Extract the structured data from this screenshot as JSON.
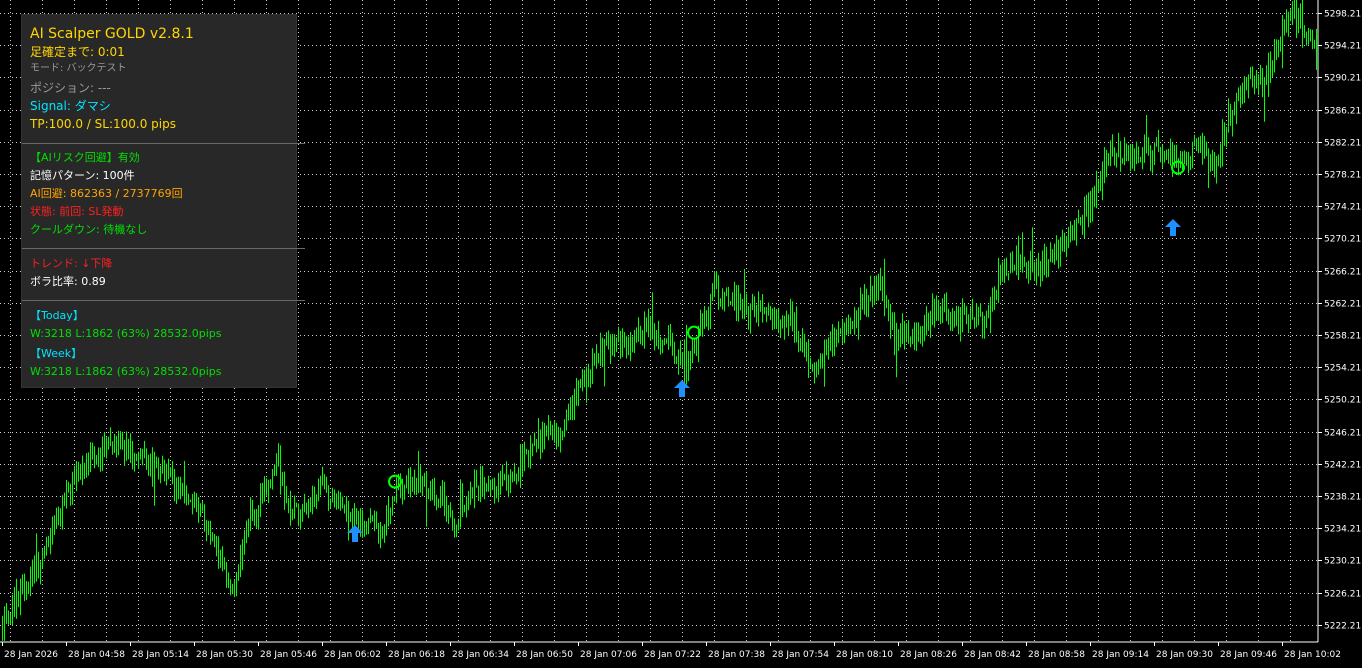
{
  "panel": {
    "title": "AI Scalper GOLD v2.8.1",
    "countdown": "足確定まで: 0:01",
    "mode": "モード: バックテスト",
    "position": "ポジション: ---",
    "signal_label": "Signal:",
    "signal_value": "ダマシ",
    "tp_sl": "TP:100.0 / SL:100.0 pips",
    "risk": "【AIリスク回避】有効",
    "memory": "記憶パターン: 100件",
    "avoid": "AI回避: 862363 / 2737769回",
    "state": "状態: 前回: SL発動",
    "cooldown": "クールダウン: 待機なし",
    "trend": "トレンド: ↓下降",
    "vol": "ボラ比率: 0.89",
    "today_h": "【Today】",
    "today": "W:3218 L:1862 (63%) 28532.0pips",
    "week_h": "【Week】",
    "week": "W:3218 L:1862 (63%) 28532.0pips",
    "colors": {
      "title": "#ffd700",
      "cyan": "#00e5ff",
      "green": "#00e000",
      "orange": "#ffa500",
      "red": "#ff2020",
      "white": "#ffffff",
      "gray": "#9a9a9a"
    }
  },
  "chart_data": {
    "type": "candlestick",
    "symbol": "GOLD",
    "y_ticks": [
      "5298.21",
      "5294.21",
      "5290.21",
      "5286.21",
      "5282.21",
      "5278.21",
      "5274.21",
      "5270.21",
      "5266.21",
      "5262.21",
      "5258.21",
      "5254.21",
      "5250.21",
      "5246.21",
      "5242.21",
      "5238.21",
      "5234.21",
      "5230.21",
      "5226.21",
      "5222.21"
    ],
    "x_ticks": [
      "28 Jan 2026",
      "28 Jan 04:58",
      "28 Jan 05:14",
      "28 Jan 05:30",
      "28 Jan 05:46",
      "28 Jan 06:02",
      "28 Jan 06:18",
      "28 Jan 06:34",
      "28 Jan 06:50",
      "28 Jan 07:06",
      "28 Jan 07:22",
      "28 Jan 07:38",
      "28 Jan 07:54",
      "28 Jan 08:10",
      "28 Jan 08:26",
      "28 Jan 08:42",
      "28 Jan 08:58",
      "28 Jan 09:14",
      "28 Jan 09:30",
      "28 Jan 09:46",
      "28 Jan 10:02"
    ],
    "ylim": [
      5220.21,
      5299.81
    ],
    "candle_color": "#00ff00",
    "grid_color": "#ffffff",
    "grid": true,
    "price_path": [
      [
        0,
        5221.5
      ],
      [
        20,
        5226
      ],
      [
        50,
        5233
      ],
      [
        75,
        5241
      ],
      [
        100,
        5244
      ],
      [
        115,
        5245
      ],
      [
        150,
        5242
      ],
      [
        190,
        5238
      ],
      [
        215,
        5233
      ],
      [
        232,
        5226
      ],
      [
        245,
        5234
      ],
      [
        262,
        5238
      ],
      [
        275,
        5243
      ],
      [
        290,
        5236
      ],
      [
        302,
        5236
      ],
      [
        322,
        5240
      ],
      [
        338,
        5237
      ],
      [
        360,
        5235
      ],
      [
        382,
        5234
      ],
      [
        395,
        5239
      ],
      [
        420,
        5240
      ],
      [
        440,
        5238
      ],
      [
        455,
        5235
      ],
      [
        475,
        5240
      ],
      [
        500,
        5239
      ],
      [
        520,
        5242
      ],
      [
        545,
        5247
      ],
      [
        560,
        5245
      ],
      [
        575,
        5251
      ],
      [
        600,
        5256
      ],
      [
        625,
        5257
      ],
      [
        650,
        5259
      ],
      [
        670,
        5257
      ],
      [
        685,
        5254
      ],
      [
        700,
        5259
      ],
      [
        715,
        5264
      ],
      [
        740,
        5262
      ],
      [
        765,
        5261
      ],
      [
        790,
        5260
      ],
      [
        815,
        5254
      ],
      [
        835,
        5258
      ],
      [
        860,
        5262
      ],
      [
        880,
        5264
      ],
      [
        895,
        5257
      ],
      [
        915,
        5258
      ],
      [
        935,
        5261
      ],
      [
        960,
        5260
      ],
      [
        985,
        5260
      ],
      [
        1000,
        5266
      ],
      [
        1015,
        5268
      ],
      [
        1040,
        5266
      ],
      [
        1060,
        5269
      ],
      [
        1080,
        5272
      ],
      [
        1095,
        5276
      ],
      [
        1110,
        5281
      ],
      [
        1135,
        5281
      ],
      [
        1160,
        5281
      ],
      [
        1180,
        5280
      ],
      [
        1200,
        5281
      ],
      [
        1215,
        5279
      ],
      [
        1228,
        5285
      ],
      [
        1245,
        5289
      ],
      [
        1265,
        5290
      ],
      [
        1278,
        5295
      ],
      [
        1293,
        5298
      ],
      [
        1305,
        5296
      ],
      [
        1315,
        5294
      ]
    ],
    "signals": [
      {
        "type": "buy-arrow",
        "time_x": 355,
        "price": 5233.5,
        "color": "#1e90ff"
      },
      {
        "type": "buy-arrow",
        "time_x": 682,
        "price": 5251.5,
        "color": "#1e90ff"
      },
      {
        "type": "buy-arrow",
        "time_x": 1173,
        "price": 5271.5,
        "color": "#1e90ff"
      },
      {
        "type": "circle",
        "time_x": 395,
        "price": 5240,
        "color": "#00ff00"
      },
      {
        "type": "circle",
        "time_x": 694,
        "price": 5258.5,
        "color": "#00ff00"
      },
      {
        "type": "circle",
        "time_x": 1178,
        "price": 5279,
        "color": "#00ff00"
      }
    ]
  }
}
